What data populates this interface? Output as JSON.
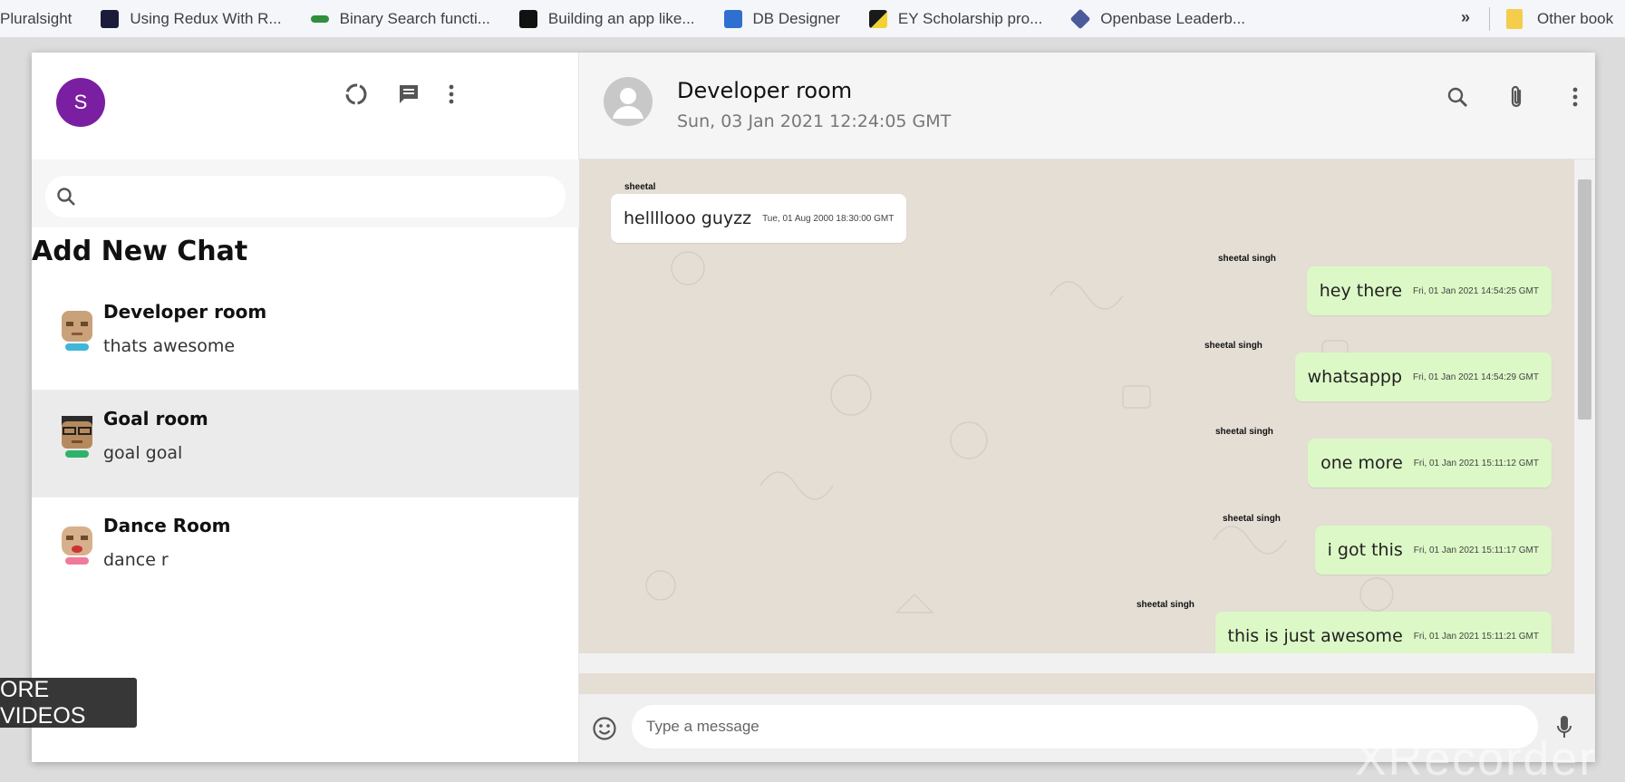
{
  "bookmarks": {
    "items": [
      {
        "label": "Pluralsight",
        "color": "#ffffff"
      },
      {
        "label": "Using Redux With R...",
        "color": "#1b1b3a"
      },
      {
        "label": "Binary Search functi...",
        "color": "#2f8f3a"
      },
      {
        "label": "Building an app like...",
        "color": "#111111"
      },
      {
        "label": "DB Designer",
        "color": "#2f6fd0"
      },
      {
        "label": "EY Scholarship pro...",
        "color": "#1a1a1a"
      },
      {
        "label": "Openbase Leaderb...",
        "color": "#4a5a9a"
      }
    ],
    "more": "»",
    "other_label": "Other book"
  },
  "sidebar": {
    "avatar_letter": "S",
    "search_placeholder": "",
    "add_chat_label": "Add New Chat",
    "chats": [
      {
        "name": "Developer room",
        "last_message": "thats awesome",
        "face_color": "#c9a27a"
      },
      {
        "name": "Goal room",
        "last_message": "goal goal",
        "face_color": "#b58a5e"
      },
      {
        "name": "Dance Room",
        "last_message": "dance r",
        "face_color": "#d6b08c"
      }
    ]
  },
  "overlay": {
    "more_videos": "ORE VIDEOS",
    "watermark": "XRecorder"
  },
  "chat": {
    "title": "Developer room",
    "last_seen": "Sun, 03 Jan 2021 12:24:05 GMT",
    "input_placeholder": "Type a message",
    "messages": [
      {
        "sender": "sheetal",
        "text": "hellllooo guyzz",
        "time": "Tue, 01 Aug 2000 18:30:00 GMT",
        "direction": "in"
      },
      {
        "sender": "sheetal singh",
        "text": "hey there",
        "time": "Fri, 01 Jan 2021 14:54:25 GMT",
        "direction": "out"
      },
      {
        "sender": "sheetal singh",
        "text": "whatsappp",
        "time": "Fri, 01 Jan 2021 14:54:29 GMT",
        "direction": "out"
      },
      {
        "sender": "sheetal singh",
        "text": "one more",
        "time": "Fri, 01 Jan 2021 15:11:12 GMT",
        "direction": "out"
      },
      {
        "sender": "sheetal singh",
        "text": "i got this",
        "time": "Fri, 01 Jan 2021 15:11:17 GMT",
        "direction": "out"
      },
      {
        "sender": "sheetal singh",
        "text": "this is just awesome",
        "time": "Fri, 01 Jan 2021 15:11:21 GMT",
        "direction": "out"
      }
    ]
  },
  "colors": {
    "avatar_bg": "#7b1fa2",
    "outgoing_bubble": "#dcf8c6",
    "chat_background": "#e4ded5"
  }
}
